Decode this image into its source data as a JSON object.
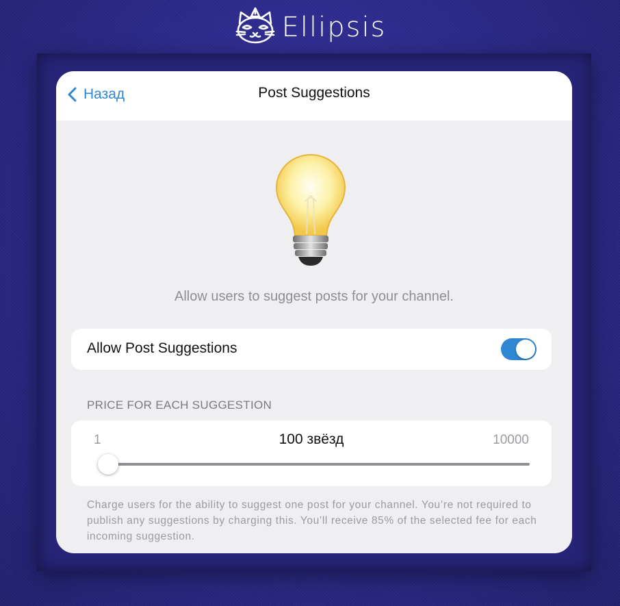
{
  "brand": {
    "name": "Ellipsis",
    "logo_icon": "cat-logo-icon"
  },
  "navbar": {
    "back_label": "Назад",
    "back_icon": "chevron-left-icon",
    "title": "Post Suggestions"
  },
  "hero": {
    "icon": "lightbulb-icon",
    "description": "Allow users to suggest posts for your channel."
  },
  "toggle": {
    "label": "Allow Post Suggestions",
    "state": true
  },
  "price": {
    "section_header": "PRICE FOR EACH SUGGESTION",
    "min_label": "1",
    "max_label": "10000",
    "value_label": "100 звёзд",
    "slider_fraction": 0.01
  },
  "footnote": "Charge users for the ability to suggest one post for your channel. You’re not required to publish any suggestions by charging this. You’ll receive 85% of the selected fee for each incoming suggestion.",
  "colors": {
    "accent": "#2f86d2",
    "background": "#2a2888",
    "card": "#efeff1"
  }
}
